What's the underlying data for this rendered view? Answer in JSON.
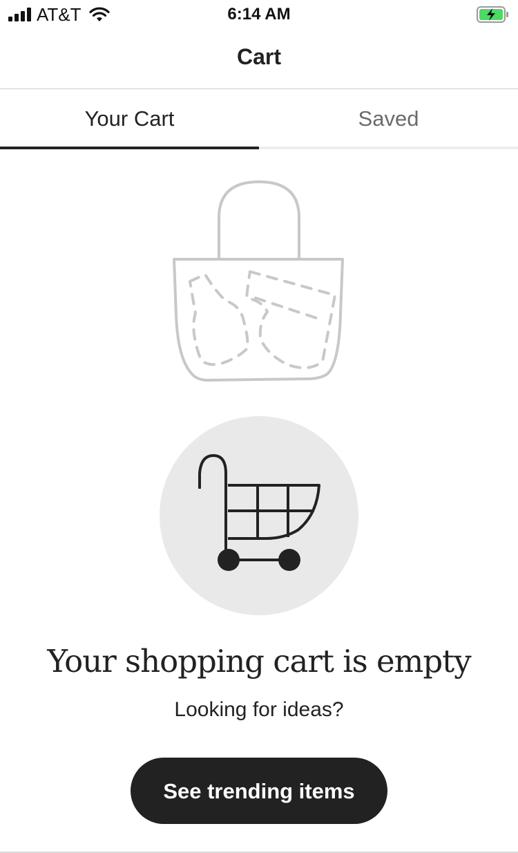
{
  "status_bar": {
    "carrier": "AT&T",
    "time": "6:14 AM",
    "icons": [
      "signal-icon",
      "wifi-icon",
      "battery-charging-icon"
    ]
  },
  "nav": {
    "title": "Cart"
  },
  "tabs": [
    {
      "label": "Your Cart",
      "active": true
    },
    {
      "label": "Saved",
      "active": false
    }
  ],
  "illustrations": {
    "top": "shopping-bag-icon",
    "middle": "shopping-cart-icon"
  },
  "empty_state": {
    "title": "Your shopping cart is empty",
    "subtitle": "Looking for ideas?",
    "button_label": "See trending items"
  },
  "colors": {
    "primary": "#222222",
    "tab_inactive_text": "#6b6b6b",
    "circle_bg": "#e9e9e9",
    "battery_green": "#4cd964"
  }
}
